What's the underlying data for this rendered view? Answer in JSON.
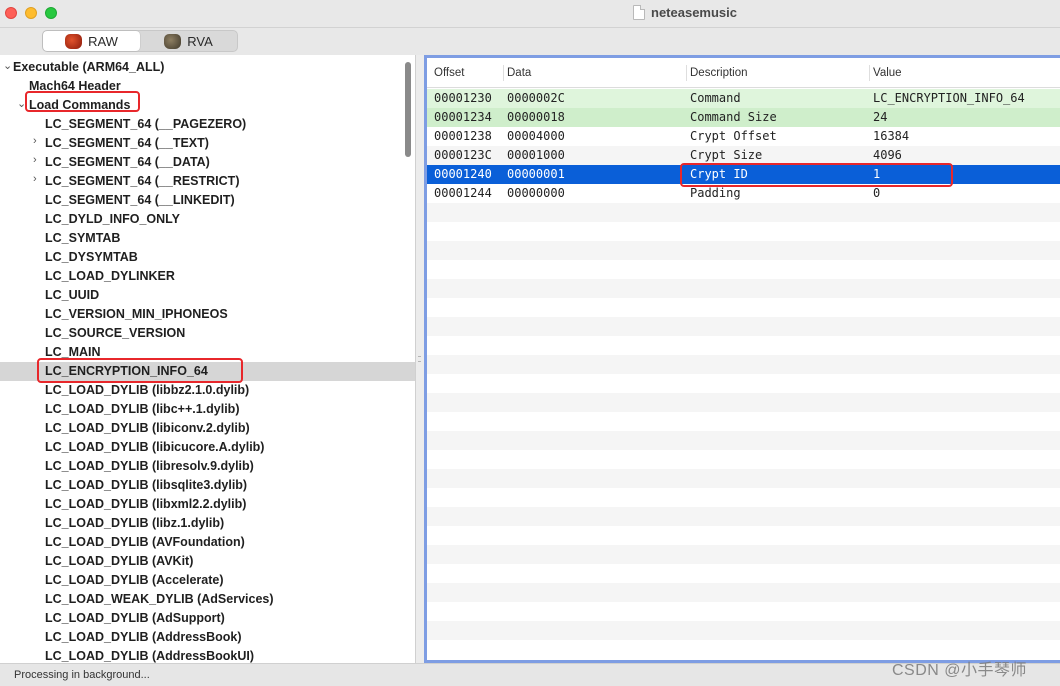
{
  "window": {
    "title": "neteasemusic"
  },
  "toolbar": {
    "modes": [
      {
        "label": "RAW"
      },
      {
        "label": "RVA"
      }
    ]
  },
  "tree": {
    "items": [
      {
        "label": "Executable  (ARM64_ALL)",
        "disclosure": "expanded"
      },
      {
        "label": "Mach64 Header"
      },
      {
        "label": "Load Commands",
        "disclosure": "expanded"
      },
      {
        "label": "LC_SEGMENT_64 (__PAGEZERO)"
      },
      {
        "label": "LC_SEGMENT_64 (__TEXT)",
        "disclosure": "collapsed"
      },
      {
        "label": "LC_SEGMENT_64 (__DATA)",
        "disclosure": "collapsed"
      },
      {
        "label": "LC_SEGMENT_64 (__RESTRICT)",
        "disclosure": "collapsed"
      },
      {
        "label": "LC_SEGMENT_64 (__LINKEDIT)"
      },
      {
        "label": "LC_DYLD_INFO_ONLY"
      },
      {
        "label": "LC_SYMTAB"
      },
      {
        "label": "LC_DYSYMTAB"
      },
      {
        "label": "LC_LOAD_DYLINKER"
      },
      {
        "label": "LC_UUID"
      },
      {
        "label": "LC_VERSION_MIN_IPHONEOS"
      },
      {
        "label": "LC_SOURCE_VERSION"
      },
      {
        "label": "LC_MAIN"
      },
      {
        "label": "LC_ENCRYPTION_INFO_64",
        "selected": true
      },
      {
        "label": "LC_LOAD_DYLIB (libbz2.1.0.dylib)"
      },
      {
        "label": "LC_LOAD_DYLIB (libc++.1.dylib)"
      },
      {
        "label": "LC_LOAD_DYLIB (libiconv.2.dylib)"
      },
      {
        "label": "LC_LOAD_DYLIB (libicucore.A.dylib)"
      },
      {
        "label": "LC_LOAD_DYLIB (libresolv.9.dylib)"
      },
      {
        "label": "LC_LOAD_DYLIB (libsqlite3.dylib)"
      },
      {
        "label": "LC_LOAD_DYLIB (libxml2.2.dylib)"
      },
      {
        "label": "LC_LOAD_DYLIB (libz.1.dylib)"
      },
      {
        "label": "LC_LOAD_DYLIB (AVFoundation)"
      },
      {
        "label": "LC_LOAD_DYLIB (AVKit)"
      },
      {
        "label": "LC_LOAD_DYLIB (Accelerate)"
      },
      {
        "label": "LC_LOAD_WEAK_DYLIB (AdServices)"
      },
      {
        "label": "LC_LOAD_DYLIB (AdSupport)"
      },
      {
        "label": "LC_LOAD_DYLIB (AddressBook)"
      },
      {
        "label": "LC_LOAD_DYLIB (AddressBookUI)"
      }
    ]
  },
  "table": {
    "headers": {
      "offset": "Offset",
      "data": "Data",
      "description": "Description",
      "value": "Value"
    },
    "rows": [
      {
        "offset": "00001230",
        "data": "0000002C",
        "description": "Command",
        "value": "LC_ENCRYPTION_INFO_64"
      },
      {
        "offset": "00001234",
        "data": "00000018",
        "description": "Command Size",
        "value": "24"
      },
      {
        "offset": "00001238",
        "data": "00004000",
        "description": "Crypt Offset",
        "value": "16384"
      },
      {
        "offset": "0000123C",
        "data": "00001000",
        "description": "Crypt Size",
        "value": "4096"
      },
      {
        "offset": "00001240",
        "data": "00000001",
        "description": "Crypt ID",
        "value": "1",
        "selected": true
      },
      {
        "offset": "00001244",
        "data": "00000000",
        "description": "Padding",
        "value": "0"
      }
    ]
  },
  "status": {
    "text": "Processing in background..."
  },
  "watermark": {
    "text": "CSDN @小手琴师"
  },
  "colors": {
    "selection_blue": "#0a5fd8",
    "highlight_green": "#dff5dc",
    "annotation_red": "#e8272b",
    "pane_focus_border": "#7e9de3"
  }
}
